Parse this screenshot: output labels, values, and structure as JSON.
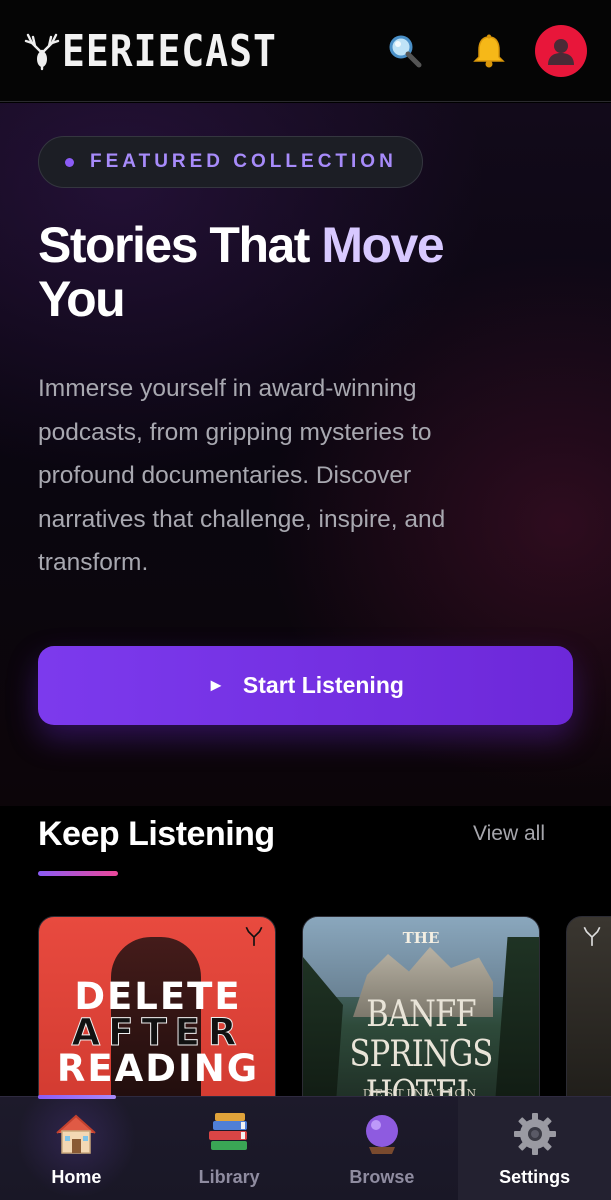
{
  "header": {
    "logo_text": "EERIECAST",
    "icons": [
      "deer-antler-logo-icon",
      "search-icon",
      "bell-icon",
      "user-avatar-icon"
    ]
  },
  "hero": {
    "badge": "FEATURED COLLECTION",
    "title_part1": "Stories That ",
    "title_part2": "Move",
    "title_part3": "You",
    "description": "Immerse yourself in award-winning podcasts, from gripping mysteries to profound documentaries. Discover narratives that challenge, inspire, and transform.",
    "cta_icon": "►",
    "cta_label": "Start Listening"
  },
  "keep_listening": {
    "title": "Keep Listening",
    "view_all": "View all",
    "cards": [
      {
        "name": "Delete After Reading",
        "lines": [
          "DELETE",
          "AFTER",
          "READING"
        ]
      },
      {
        "name": "The Banff Springs Hotel",
        "top": "THE",
        "title_lines": [
          "BANFF SPRINGS",
          "HOTEL"
        ],
        "sub": "DESTINATION"
      },
      {
        "name": ""
      }
    ]
  },
  "nav": {
    "items": [
      {
        "label": "Home",
        "icon": "house-icon"
      },
      {
        "label": "Library",
        "icon": "books-icon"
      },
      {
        "label": "Browse",
        "icon": "crystal-ball-icon"
      },
      {
        "label": "Settings",
        "icon": "gear-icon"
      }
    ]
  },
  "colors": {
    "accent": "#7c3aed",
    "accent_light": "#a78bfa",
    "avatar_bg": "#e8163a",
    "background": "#000000"
  }
}
